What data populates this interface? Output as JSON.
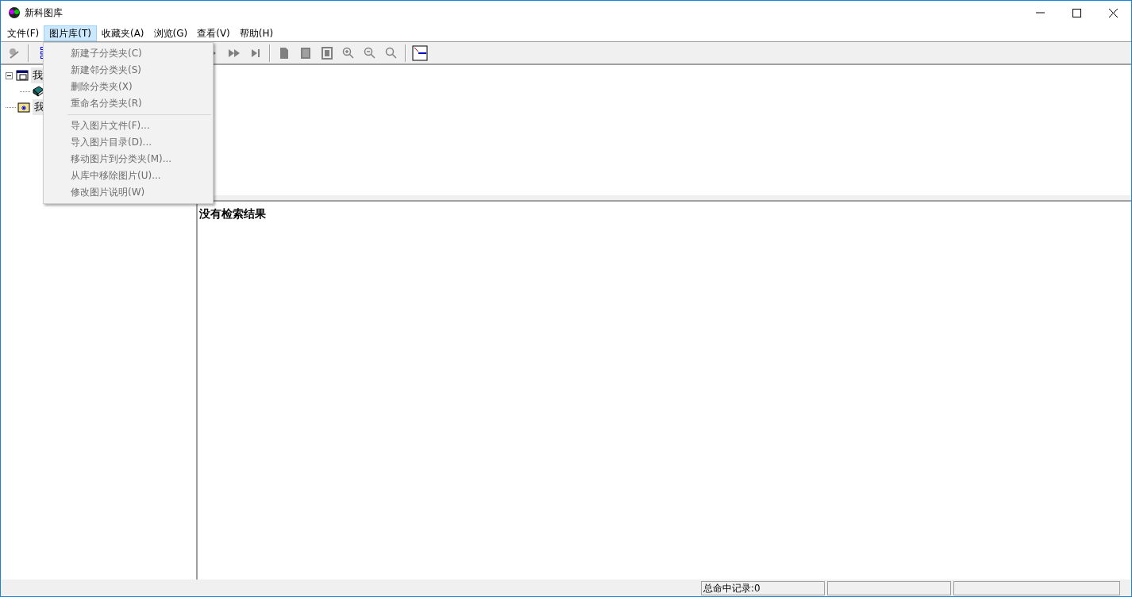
{
  "window": {
    "title": "新科图库"
  },
  "menu_bar": [
    {
      "label": "文件(F)",
      "selected": false
    },
    {
      "label": "图片库(T)",
      "selected": true
    },
    {
      "label": "收藏夹(A)",
      "selected": false
    },
    {
      "label": "浏览(G)",
      "selected": false
    },
    {
      "label": "查看(V)",
      "selected": false
    },
    {
      "label": "帮助(H)",
      "selected": false
    }
  ],
  "dropdown": {
    "sections": [
      [
        {
          "label": "新建子分类夹(C)",
          "disabled": true
        },
        {
          "label": "新建邻分类夹(S)",
          "disabled": true
        },
        {
          "label": "删除分类夹(X)",
          "disabled": true
        },
        {
          "label": "重命名分类夹(R)",
          "disabled": true
        }
      ],
      [
        {
          "label": "导入图片文件(F)...",
          "disabled": true
        },
        {
          "label": "导入图片目录(D)...",
          "disabled": true
        },
        {
          "label": "移动图片到分类夹(M)...",
          "disabled": true
        },
        {
          "label": "从库中移除图片(U)...",
          "disabled": true
        },
        {
          "label": "修改图片说明(W)",
          "disabled": true
        }
      ]
    ]
  },
  "tree": [
    {
      "label": "我",
      "kind": "library",
      "expanded": true,
      "children": [
        {
          "kind": "book"
        }
      ]
    },
    {
      "label": "我",
      "kind": "favorites"
    }
  ],
  "results": {
    "message": "没有检索结果"
  },
  "status_bar": {
    "records": "总命中记录:0"
  }
}
